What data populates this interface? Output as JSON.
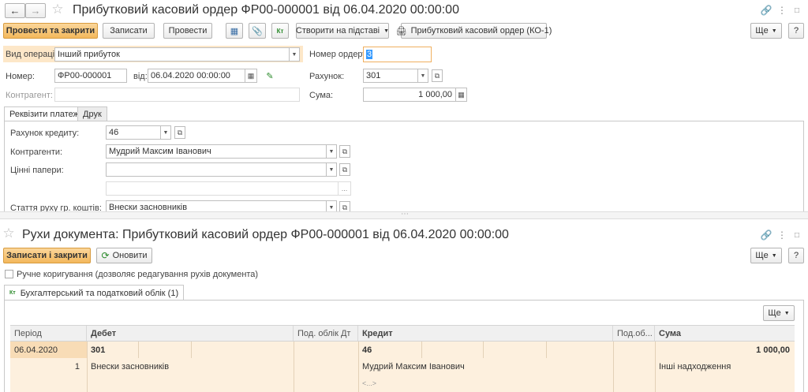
{
  "window1": {
    "title": "Прибутковий касовий ордер ФР00-000001 від 06.04.2020 00:00:00",
    "toolbar": {
      "post_close": "Провести та закрити",
      "save": "Записати",
      "post": "Провести",
      "create_based": "Створити на підставі",
      "print_form": "Прибутковий касовий ордер (КО-1)",
      "more": "Ще",
      "help": "?"
    },
    "form": {
      "operation_label": "Вид операції:",
      "operation_value": "Інший прибуток",
      "order_no_label": "Номер ордеру:",
      "order_no_value": "3",
      "number_label": "Номер:",
      "number_value": "ФР00-000001",
      "from_label": "від:",
      "date_value": "06.04.2020 00:00:00",
      "account_label": "Рахунок:",
      "account_value": "301",
      "counterparty_label": "Контрагент:",
      "sum_label": "Сума:",
      "sum_value": "1 000,00"
    },
    "tabs": [
      "Реквізити платежу",
      "Друк"
    ],
    "details": {
      "credit_account_label": "Рахунок кредиту:",
      "credit_account_value": "46",
      "counterparties_label": "Контрагенти:",
      "counterparties_value": "Мудрий Максим Іванович",
      "securities_label": "Цінні папери:",
      "cashflow_label": "Стаття руху гр. коштів:",
      "cashflow_value": "Внески засновників",
      "ellipsis": "..."
    }
  },
  "window2": {
    "title": "Рухи документа: Прибутковий касовий ордер ФР00-000001 від 06.04.2020 00:00:00",
    "toolbar": {
      "save_close": "Записати і закрити",
      "refresh": "Оновити",
      "more": "Ще",
      "help": "?"
    },
    "manual_edit_label": "Ручне коригування (дозволяє редагування рухів документа)",
    "tab": "Бухгалтерський та податковий облік (1)",
    "grid_more": "Ще",
    "grid": {
      "columns": [
        "Період",
        "Дебет",
        "Под. облік Дт",
        "Кредит",
        "Под.об...",
        "Сума"
      ],
      "row": {
        "period": "06.04.2020",
        "debit": "301",
        "credit": "46",
        "sum": "1 000,00",
        "line_no": "1",
        "debit_sub": "Внески засновників",
        "credit_sub": "Мудрий Максим Іванович",
        "note": "Інші надходження",
        "empty_mark": "<...>"
      }
    }
  },
  "accent": "#f3b85c"
}
